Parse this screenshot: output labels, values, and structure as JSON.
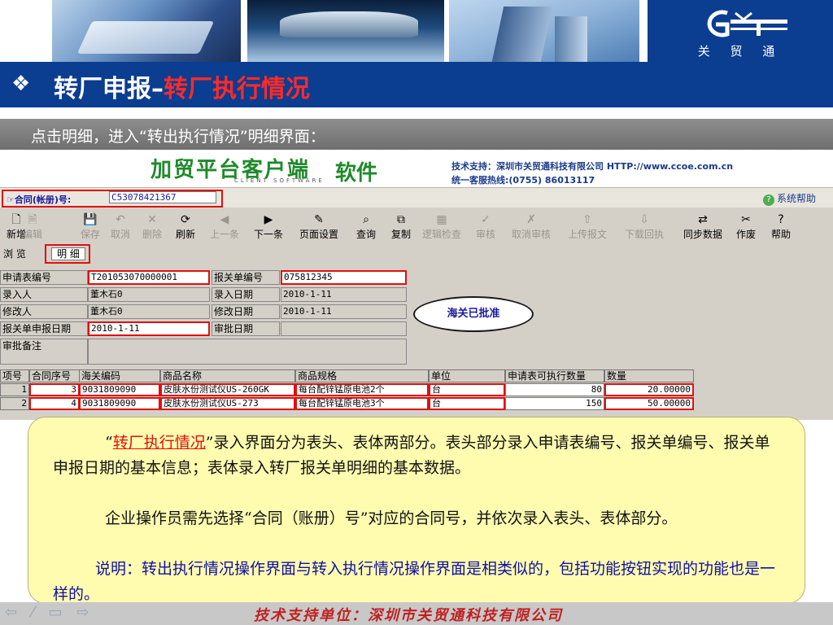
{
  "logo": {
    "mark": "GMT",
    "text": "关 贸 通"
  },
  "slide": {
    "bullet": "❖",
    "title_main": "转厂申报",
    "title_sep": "–",
    "title_sub": "转厂执行情况",
    "instruction": "点击明细，进入“转出执行情况”明细界面："
  },
  "app": {
    "name": "加贸平台客户端",
    "name_suffix": "软件",
    "subtitle": "CLIENT SOFTWARE",
    "support_label": "技术支持：深圳市关贸通科技有限公司",
    "support_url": "HTTP://www.ccoe.com.cn",
    "hotline": "统一客服热线:(0755) 86013117",
    "contract_label": "☞合同(帐册)号:",
    "contract_value": "C53078421367",
    "system_help": "系统帮助",
    "toolbar": [
      {
        "label": "新增",
        "icon": "new-doc-icon",
        "glyph": "🗋",
        "enabled": true
      },
      {
        "label": "编辑",
        "icon": "edit-icon",
        "glyph": "🗎",
        "enabled": false
      },
      {
        "label": "保存",
        "icon": "save-icon",
        "glyph": "💾",
        "enabled": false
      },
      {
        "label": "取消",
        "icon": "undo-icon",
        "glyph": "↶",
        "enabled": false
      },
      {
        "label": "删除",
        "icon": "delete-icon",
        "glyph": "✕",
        "enabled": false
      },
      {
        "label": "刷新",
        "icon": "refresh-icon",
        "glyph": "⟳",
        "enabled": true
      },
      {
        "label": "上一条",
        "icon": "prev-icon",
        "glyph": "◀",
        "enabled": false
      },
      {
        "label": "下一条",
        "icon": "next-icon",
        "glyph": "▶",
        "enabled": true
      },
      {
        "label": "页面设置",
        "icon": "page-setup-icon",
        "glyph": "✎",
        "enabled": true
      },
      {
        "label": "查询",
        "icon": "search-icon",
        "glyph": "⌕",
        "enabled": true
      },
      {
        "label": "复制",
        "icon": "copy-icon",
        "glyph": "⧉",
        "enabled": true
      },
      {
        "label": "逻辑检查",
        "icon": "logic-check-icon",
        "glyph": "▦",
        "enabled": false
      },
      {
        "label": "审核",
        "icon": "approve-icon",
        "glyph": "✓",
        "enabled": false
      },
      {
        "label": "取消审核",
        "icon": "cancel-approve-icon",
        "glyph": "✗",
        "enabled": false
      },
      {
        "label": "上传报文",
        "icon": "upload-icon",
        "glyph": "⇧",
        "enabled": false
      },
      {
        "label": "下载回执",
        "icon": "download-icon",
        "glyph": "⇩",
        "enabled": false
      },
      {
        "label": "同步数据",
        "icon": "sync-icon",
        "glyph": "⇄",
        "enabled": true
      },
      {
        "label": "作废",
        "icon": "void-icon",
        "glyph": "✂",
        "enabled": true
      },
      {
        "label": "帮助",
        "icon": "help-icon",
        "glyph": "?",
        "enabled": true
      }
    ],
    "tabs": {
      "browse": "浏 览",
      "detail": "明 细"
    },
    "form": {
      "app_no_label": "申请表编号",
      "app_no": "T201053070000001",
      "decl_no_label": "报关单编号",
      "decl_no": "075812345",
      "entered_by_label": "录入人",
      "entered_by": "董木石0",
      "entry_date_label": "录入日期",
      "entry_date": "2010-1-11",
      "modified_by_label": "修改人",
      "modified_by": "董木石0",
      "modify_date_label": "修改日期",
      "modify_date": "2010-1-11",
      "decl_date_label": "报关单申报日期",
      "decl_date": "2010-1-11",
      "approve_date_label": "审批日期",
      "approve_date": "",
      "approve_note_label": "审批备注",
      "approve_note": ""
    },
    "status_stamp": "海关已批准",
    "grid": {
      "headers": [
        "项号",
        "合同序号",
        "海关编码",
        "商品名称",
        "商品规格",
        "单位",
        "申请表可执行数量",
        "数量"
      ],
      "rows": [
        [
          "1",
          "3",
          "9031809090",
          "皮肤水份测试仪US-260GK",
          "每台配锌锰原电池2个",
          "台",
          "80",
          "20.00000"
        ],
        [
          "2",
          "4",
          "9031809090",
          "皮肤水份测试仪US-273",
          "每台配锌锰原电池3个",
          "台",
          "150",
          "50.00000"
        ]
      ]
    }
  },
  "callout": {
    "p1_open": "“",
    "p1_highlight": "转厂执行情况",
    "p1_rest": "”录入界面分为表头、表体两部分。表头部分录入申请表编号、报关单编号、报关单申报日期的基本信息；表体录入转厂报关单明细的基本数据。",
    "p2": "企业操作员需先选择“合同（账册）号”对应的合同号，并依次录入表头、表体部分。",
    "p3": "说明：转出执行情况操作界面与转入执行情况操作界面是相类似的，包括功能按钮实现的功能也是一样的。"
  },
  "footer": {
    "nav": "⇦ ⁄ ▭ ⇨",
    "text": "技术支持单位：深圳市关贸通科技有限公司"
  },
  "colors": {
    "brand_blue": "#0b3d91",
    "title_red": "#ff2a2a",
    "highlight_red": "#e01010",
    "callout_bg": "#fffcb0"
  }
}
